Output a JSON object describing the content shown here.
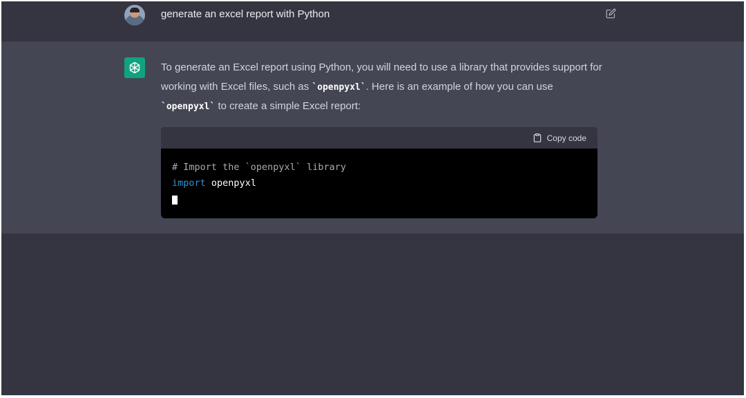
{
  "user_message": {
    "text": "generate an excel report with Python",
    "avatar_icon": "user-avatar",
    "edit_icon": "edit-icon"
  },
  "assistant_message": {
    "avatar_icon": "openai-logo-icon",
    "part1": "To generate an Excel report using Python, you will need to use a library that provides support for working with Excel files, such as ",
    "code1": "`openpyxl`",
    "part2": ". Here is an example of how you can use ",
    "code2": "`openpyxl`",
    "part3": " to create a simple Excel report:"
  },
  "code_block": {
    "copy_label": "Copy code",
    "copy_icon": "clipboard-icon",
    "comment_line": "# Import the `openpyxl` library",
    "import_keyword": "import",
    "import_module": "openpyxl"
  },
  "colors": {
    "background": "#343541",
    "assistant_background": "#444654",
    "gpt_brand": "#10a37f",
    "keyword": "#2e95d3"
  }
}
